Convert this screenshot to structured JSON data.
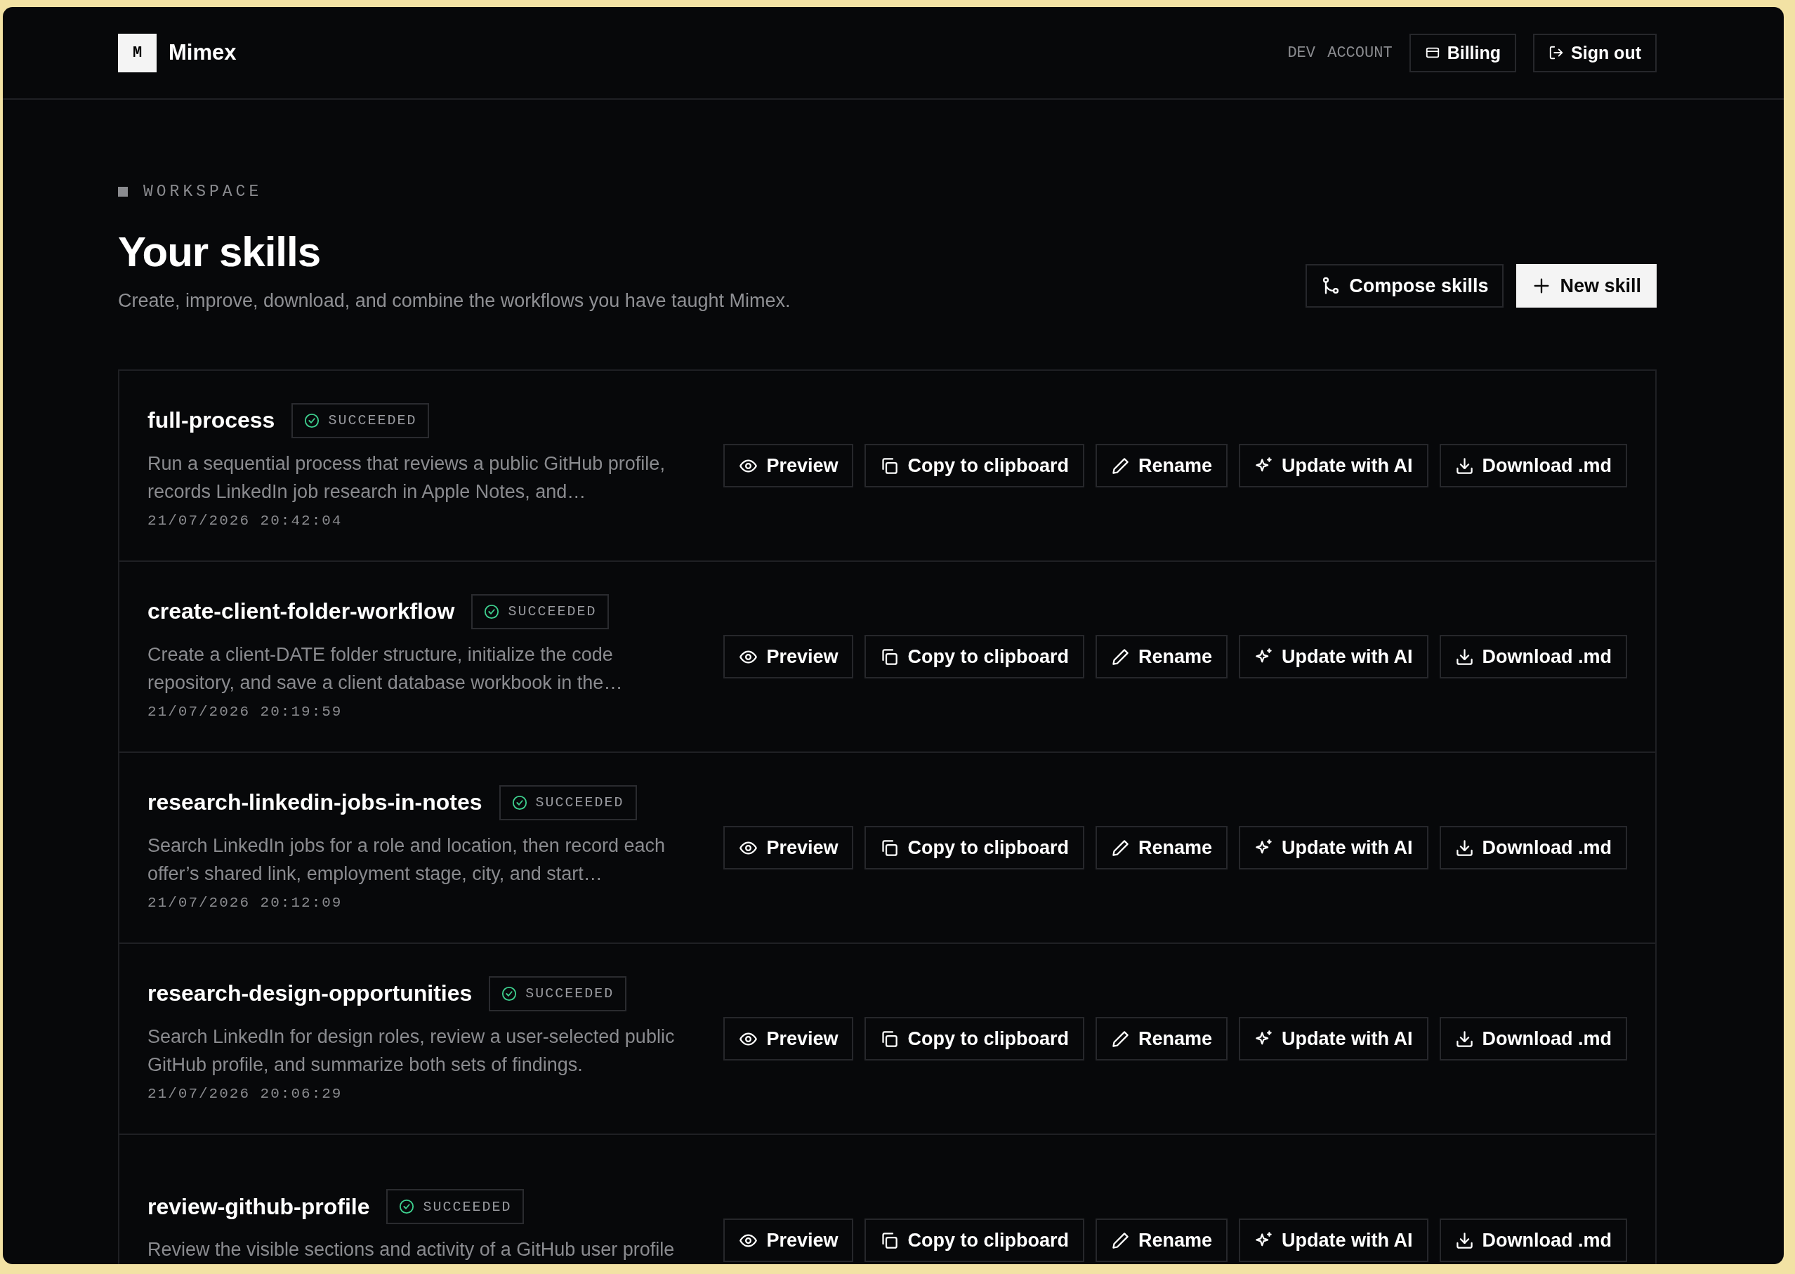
{
  "header": {
    "logo_letter": "M",
    "brand": "Mimex",
    "account": "DEV ACCOUNT",
    "buttons": [
      {
        "kind": "billing",
        "label": "Billing"
      },
      {
        "kind": "signout",
        "label": "Sign out"
      }
    ]
  },
  "hero": {
    "eyebrow": "WORKSPACE",
    "title": "Your skills",
    "subtitle": "Create, improve, download, and combine the workflows you have taught Mimex.",
    "buttons": [
      {
        "kind": "compose",
        "label": "Compose skills"
      },
      {
        "kind": "new",
        "label": "New skill"
      }
    ]
  },
  "skills": [
    {
      "name": "full-process",
      "status": "SUCCEEDED",
      "description": "Run a sequential process that reviews a public GitHub profile, records LinkedIn job research in Apple Notes, and…",
      "timestamp": "21/07/2026 20:42:04",
      "actions": [
        {
          "kind": "preview",
          "label": "Preview"
        },
        {
          "kind": "copy",
          "label": "Copy to clipboard"
        },
        {
          "kind": "rename",
          "label": "Rename"
        },
        {
          "kind": "ai",
          "label": "Update with AI"
        },
        {
          "kind": "download",
          "label": "Download .md"
        }
      ]
    },
    {
      "name": "create-client-folder-workflow",
      "status": "SUCCEEDED",
      "description": "Create a client-DATE folder structure, initialize the code repository, and save a client database workbook in the…",
      "timestamp": "21/07/2026 20:19:59",
      "actions": [
        {
          "kind": "preview",
          "label": "Preview"
        },
        {
          "kind": "copy",
          "label": "Copy to clipboard"
        },
        {
          "kind": "rename",
          "label": "Rename"
        },
        {
          "kind": "ai",
          "label": "Update with AI"
        },
        {
          "kind": "download",
          "label": "Download .md"
        }
      ]
    },
    {
      "name": "research-linkedin-jobs-in-notes",
      "status": "SUCCEEDED",
      "description": "Search LinkedIn jobs for a role and location, then record each offer’s shared link, employment stage, city, and start…",
      "timestamp": "21/07/2026 20:12:09",
      "actions": [
        {
          "kind": "preview",
          "label": "Preview"
        },
        {
          "kind": "copy",
          "label": "Copy to clipboard"
        },
        {
          "kind": "rename",
          "label": "Rename"
        },
        {
          "kind": "ai",
          "label": "Update with AI"
        },
        {
          "kind": "download",
          "label": "Download .md"
        }
      ]
    },
    {
      "name": "research-design-opportunities",
      "status": "SUCCEEDED",
      "description": "Search LinkedIn for design roles, review a user-selected public GitHub profile, and summarize both sets of findings.",
      "timestamp": "21/07/2026 20:06:29",
      "actions": [
        {
          "kind": "preview",
          "label": "Preview"
        },
        {
          "kind": "copy",
          "label": "Copy to clipboard"
        },
        {
          "kind": "rename",
          "label": "Rename"
        },
        {
          "kind": "ai",
          "label": "Update with AI"
        },
        {
          "kind": "download",
          "label": "Download .md"
        }
      ]
    },
    {
      "name": "review-github-profile",
      "status": "SUCCEEDED",
      "description": "Review the visible sections and activity of a GitHub user profile",
      "actions": [
        {
          "kind": "preview",
          "label": "Preview"
        },
        {
          "kind": "copy",
          "label": "Copy to clipboard"
        },
        {
          "kind": "rename",
          "label": "Rename"
        },
        {
          "kind": "ai",
          "label": "Update with AI"
        },
        {
          "kind": "download",
          "label": "Download .md"
        }
      ]
    }
  ]
}
